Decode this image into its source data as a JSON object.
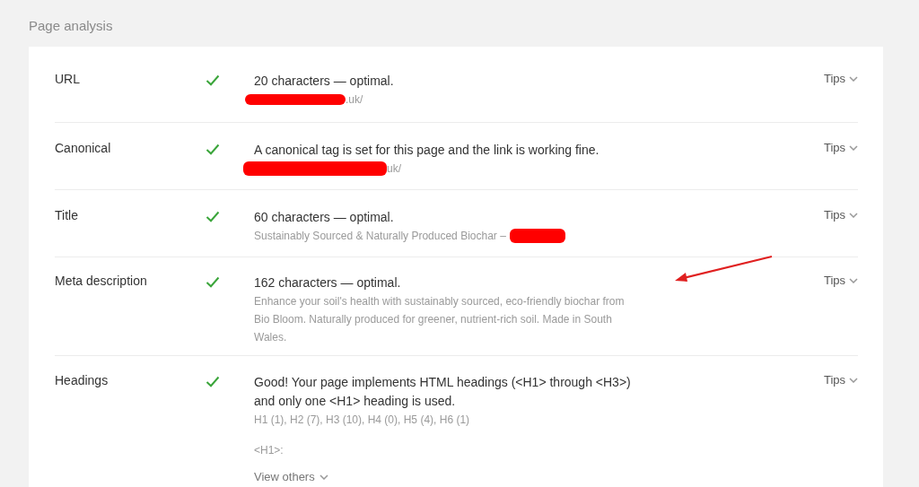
{
  "section_title": "Page analysis",
  "rows": [
    {
      "label": "URL",
      "passed": true,
      "message": "20 characters — optimal.",
      "details": [
        {
          "text": ".uk/",
          "redacted_before": true,
          "redacted_after": false
        }
      ],
      "tips": "Tips"
    },
    {
      "label": "Canonical",
      "passed": true,
      "message": "A canonical tag is set for this page and the link is working fine.",
      "details": [
        {
          "text": "uk/",
          "redacted_before": true,
          "redacted_after": false
        }
      ],
      "tips": "Tips"
    },
    {
      "label": "Title",
      "passed": true,
      "message": "60 characters — optimal.",
      "details": [
        {
          "text": "Sustainably Sourced & Naturally Produced Biochar –",
          "redacted_before": false,
          "redacted_after": true
        }
      ],
      "tips": "Tips"
    },
    {
      "label": "Meta description",
      "passed": true,
      "message": "162 characters — optimal.",
      "details": [
        {
          "text": "Enhance your soil's health with sustainably sourced, eco-friendly biochar from Bio Bloom. Naturally produced for greener, nutrient-rich soil. Made in South Wales.",
          "redacted_before": false,
          "redacted_after": false
        }
      ],
      "tips": "Tips"
    },
    {
      "label": "Headings",
      "passed": true,
      "message": "Good! Your page implements HTML headings (<H1> through <H3>) and only one <H1> heading is used.",
      "details": [
        {
          "text": "H1 (1), H2 (7), H3 (10), H4 (0), H5 (4), H6 (1)",
          "redacted_before": false,
          "redacted_after": false
        }
      ],
      "sub_label": "<H1>:",
      "link": "View others",
      "tips": "Tips"
    }
  ]
}
